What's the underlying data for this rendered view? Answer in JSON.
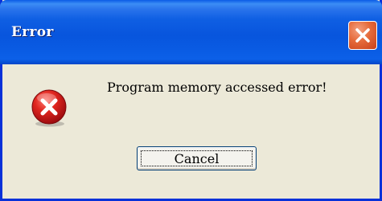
{
  "window": {
    "title": "Error",
    "close_icon": "close-icon"
  },
  "dialog": {
    "icon": "error-icon",
    "message": "Program memory accessed error!"
  },
  "buttons": {
    "cancel_label": "Cancel"
  },
  "colors": {
    "titlebar": "#0855dd",
    "dialog_bg": "#ece9d8",
    "close_button": "#e56a3a",
    "error_icon": "#d0121b"
  }
}
